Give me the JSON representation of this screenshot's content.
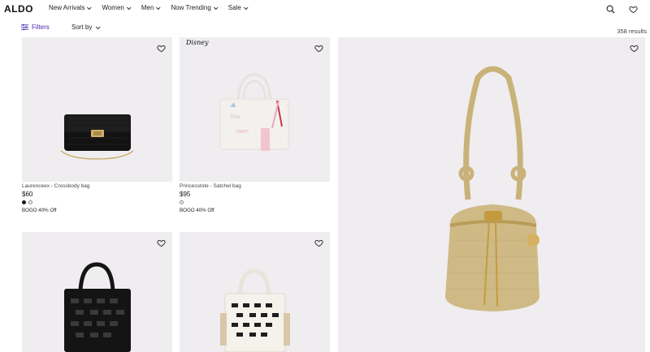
{
  "brand": {
    "logo": "ALDO"
  },
  "nav": {
    "items": [
      {
        "label": "New Arrivals"
      },
      {
        "label": "Women"
      },
      {
        "label": "Men"
      },
      {
        "label": "Now Trending"
      },
      {
        "label": "Sale"
      }
    ],
    "icons": [
      "search-icon",
      "wishlist-icon"
    ]
  },
  "toolbar": {
    "filters_label": "Filters",
    "sort_label": "Sort by",
    "results": "358 results"
  },
  "products": [
    {
      "name": "Laurenceex - Crossbody bag",
      "price": "$60",
      "swatches": [
        "#1a1a1a",
        "#f4f4f4"
      ],
      "promo": "BOGO 40% Off"
    },
    {
      "name": "Princesstote - Satchel bag",
      "price": "$95",
      "badge": "Disney",
      "swatches": [
        "#f4f4f4"
      ],
      "promo": "BOGO 40% Off"
    }
  ],
  "colors": {
    "accent": "#4b2bb0",
    "image_bg": "#efedf0"
  }
}
